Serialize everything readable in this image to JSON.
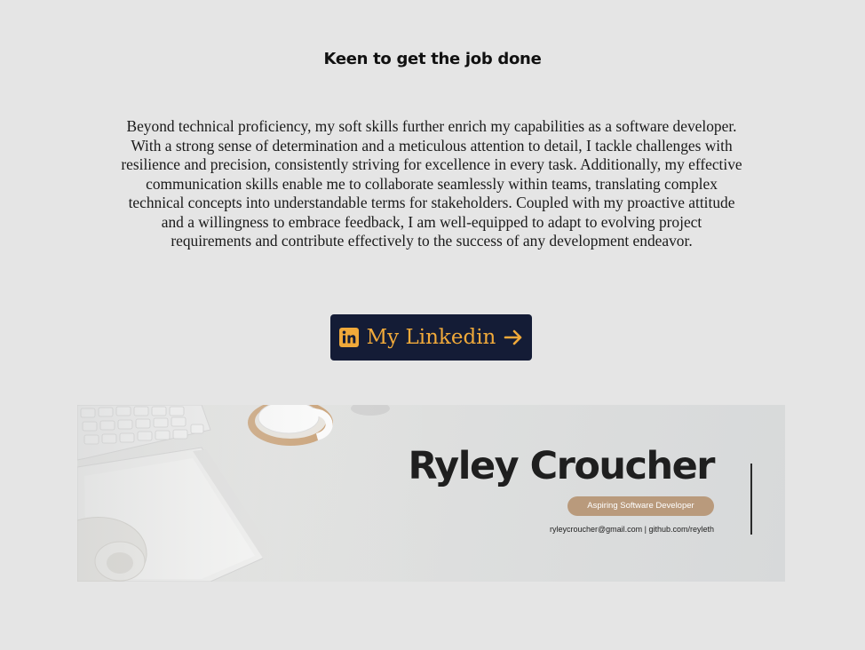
{
  "section": {
    "heading": "Keen to get the job done",
    "paragraph": "Beyond technical proficiency, my soft skills further enrich my capabilities as a software developer. With a strong sense of determination and a meticulous attention to detail, I tackle challenges with resilience and precision, consistently striving for excellence in every task. Additionally, my effective communication skills enable me to collaborate seamlessly within teams, translating complex technical concepts into understandable terms for stakeholders. Coupled with my proactive attitude and a willingness to embrace feedback, I am well-equipped to adapt to evolving project requirements and contribute effectively to the success of any development endeavor."
  },
  "linkedin_button": {
    "label": "My Linkedin",
    "icons": [
      "linkedin-icon",
      "arrow-right-icon"
    ]
  },
  "banner": {
    "name": "Ryley Croucher",
    "role": "Aspiring Software Developer",
    "contact": "ryleycroucher@gmail.com  | github.com/reyleth",
    "illustrations": [
      "keyboard",
      "notebook",
      "headphones",
      "mug",
      "cork-coaster"
    ]
  },
  "colors": {
    "page_background": "#e5e5e5",
    "button_background": "#141c36",
    "button_text": "#f0a93a",
    "badge_background": "#b99a7c"
  }
}
